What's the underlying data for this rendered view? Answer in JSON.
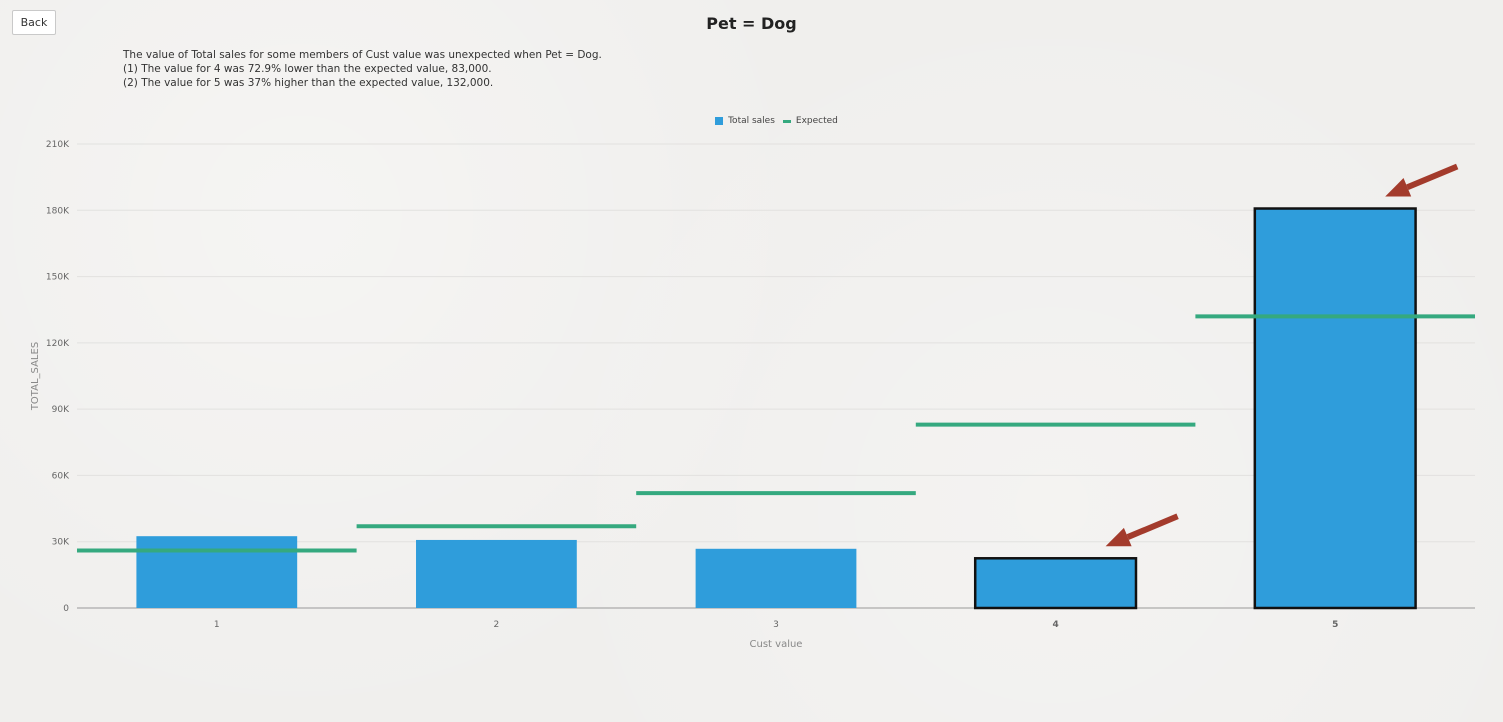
{
  "toolbar": {
    "back_label": "Back"
  },
  "header": {
    "title": "Pet = Dog"
  },
  "description": {
    "lines": [
      "The value of Total sales for some members of Cust value was unexpected when Pet = Dog.",
      "(1) The value for 4 was 72.9% lower than the expected value, 83,000.",
      "(2) The value for 5 was 37% higher than the expected value, 132,000."
    ]
  },
  "colors": {
    "bar": "#2f9ddb",
    "expected": "#35a97f",
    "highlight_outline": "#111111",
    "arrow": "#a33b2c",
    "gridline": "#e2e1df",
    "axis": "#999999"
  },
  "icons": {
    "anomaly_marker": "arrow-icon"
  },
  "chart_data": {
    "type": "bar",
    "xlabel": "Cust value",
    "ylabel": "TOTAL_SALES",
    "ylim": [
      0,
      210000
    ],
    "yticks": [
      0,
      30000,
      60000,
      90000,
      120000,
      150000,
      180000,
      210000
    ],
    "ytick_labels": [
      "0",
      "30K",
      "60K",
      "90K",
      "120K",
      "150K",
      "180K",
      "210K"
    ],
    "grid": true,
    "legend_position": "top-center",
    "categories": [
      "1",
      "2",
      "3",
      "4",
      "5"
    ],
    "series": [
      {
        "name": "Total sales",
        "kind": "bar",
        "values": [
          32500,
          30800,
          26800,
          22500,
          180800
        ]
      },
      {
        "name": "Expected",
        "kind": "line",
        "values": [
          26000,
          37000,
          52000,
          83000,
          132000
        ]
      }
    ],
    "highlighted": [
      "4",
      "5"
    ]
  }
}
